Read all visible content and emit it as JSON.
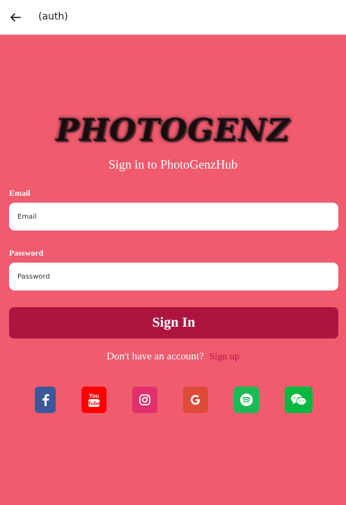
{
  "header": {
    "title": "(auth)",
    "back_icon": "arrow-left-icon"
  },
  "logo": {
    "text": "PHOTOGENZ"
  },
  "subtitle": "Sign in to PhotoGenzHub",
  "form": {
    "email_label": "Email",
    "email_placeholder": "Email",
    "email_value": "",
    "password_label": "Password",
    "password_placeholder": "Password",
    "password_value": "",
    "submit_label": "Sign In"
  },
  "signup": {
    "prompt": "Don't have an account?",
    "link": "Sign up"
  },
  "social": [
    {
      "name": "facebook-icon",
      "color": "#3b5998"
    },
    {
      "name": "youtube-icon",
      "color": "#ff0000"
    },
    {
      "name": "instagram-icon",
      "color": "#e1306c"
    },
    {
      "name": "google-icon",
      "color": "#dd4b39"
    },
    {
      "name": "spotify-icon",
      "color": "#1db954"
    },
    {
      "name": "wechat-icon",
      "color": "#09b83e"
    }
  ],
  "colors": {
    "background": "#f05b6e",
    "button": "#ad1540",
    "link": "#b8113f"
  }
}
